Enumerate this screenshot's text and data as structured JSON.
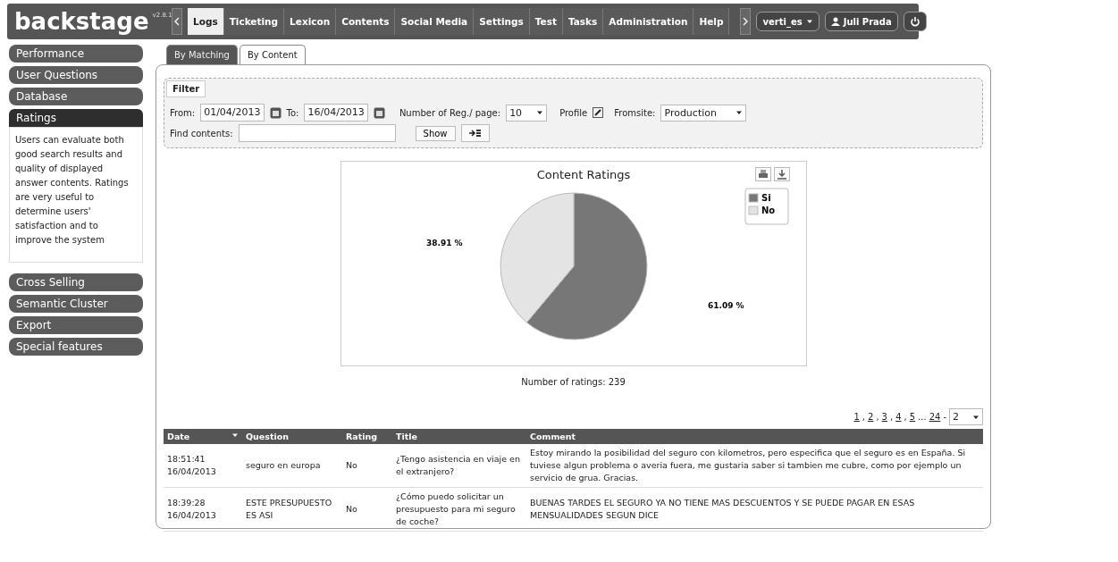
{
  "app": {
    "logo": "backstage",
    "version": "v2.8.1"
  },
  "nav": {
    "tabs": [
      {
        "label": "Logs",
        "selected": true
      },
      {
        "label": "Ticketing",
        "selected": false
      },
      {
        "label": "Lexicon",
        "selected": false
      },
      {
        "label": "Contents",
        "selected": false
      },
      {
        "label": "Social Media",
        "selected": false
      },
      {
        "label": "Settings",
        "selected": false
      },
      {
        "label": "Test",
        "selected": false
      },
      {
        "label": "Tasks",
        "selected": false
      },
      {
        "label": "Administration",
        "selected": false
      },
      {
        "label": "Help",
        "selected": false
      }
    ],
    "instance": "verti_es",
    "user": "Juli Prada"
  },
  "sidebar": {
    "items": [
      {
        "label": "Performance",
        "selected": false
      },
      {
        "label": "User Questions",
        "selected": false
      },
      {
        "label": "Database",
        "selected": false
      },
      {
        "label": "Ratings",
        "selected": true,
        "description": "Users can evaluate both good search results and quality of displayed answer contents. Ratings are very useful to determine users' satisfaction and to improve the system"
      },
      {
        "label": "Cross Selling",
        "selected": false
      },
      {
        "label": "Semantic Cluster",
        "selected": false
      },
      {
        "label": "Export",
        "selected": false
      },
      {
        "label": "Special features",
        "selected": false
      }
    ]
  },
  "subtabs": [
    {
      "label": "By Matching",
      "selected": false
    },
    {
      "label": "By Content",
      "selected": true
    }
  ],
  "filter": {
    "title": "Filter",
    "from_label": "From:",
    "from": "01/04/2013",
    "to_label": "To:",
    "to": "16/04/2013",
    "per_page_label": "Number of Reg./ page:",
    "per_page": "10",
    "profile_label": "Profile",
    "fromsite_label": "Fromsite:",
    "fromsite": "Production",
    "find_label": "Find contents:",
    "show_button": "Show"
  },
  "chart": {
    "chart_data": {
      "type": "pie",
      "title": "Content Ratings",
      "categories": [
        "Si",
        "No"
      ],
      "values": [
        61.09,
        38.91
      ],
      "colors": [
        "#777777",
        "#e4e4e4"
      ],
      "value_labels": [
        "61.09 %",
        "38.91 %"
      ],
      "legend": true
    }
  },
  "ratings_count": "Number of ratings: 239",
  "pagination": {
    "links": [
      "1",
      "2",
      "3",
      "4",
      "5"
    ],
    "comma": ",",
    "ellipsis": "...",
    "last": "24",
    "separator": "-",
    "page": "2"
  },
  "table": {
    "columns": [
      "Date",
      "Question",
      "Rating",
      "Title",
      "Comment"
    ],
    "rows": [
      {
        "time": "18:51:41",
        "date": "16/04/2013",
        "question": "seguro en europa",
        "rating": "No",
        "title": "¿Tengo asistencia en viaje en el extranjero?",
        "comment": "Estoy mirando la posibilidad del seguro con kilometros, pero especifica que el seguro es en España. Si tuviese algun problema o averia fuera, me gustaria saber si tambien me cubre, como por ejemplo un servicio de grua. Gracias."
      },
      {
        "time": "18:39:28",
        "date": "16/04/2013",
        "question": "ESTE PRESUPUESTO ES ASI",
        "rating": "No",
        "title": "¿Cómo puedo solicitar un presupuesto para mi seguro de coche?",
        "comment": "BUENAS TARDES EL SEGURO YA NO TIENE MAS DESCUENTOS Y SE PUEDE PAGAR EN ESAS MENSUALIDADES SEGUN DICE"
      }
    ]
  }
}
